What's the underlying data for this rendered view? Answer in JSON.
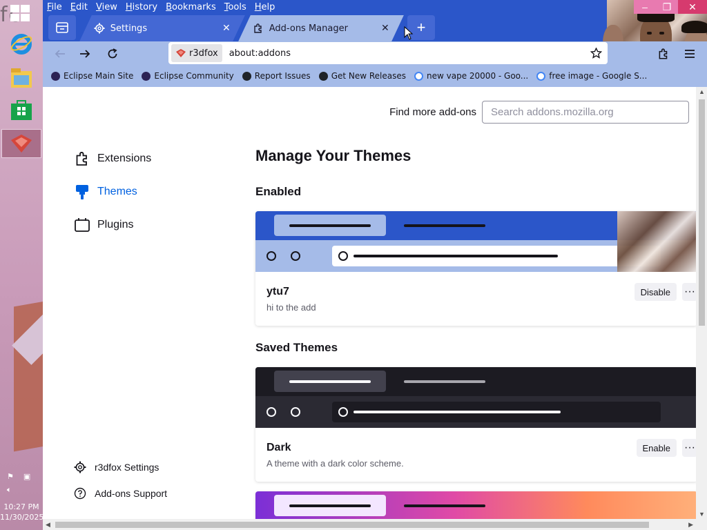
{
  "desktop": {
    "corner_text": "fc",
    "tray": {
      "time": "10:27 PM",
      "date": "11/30/2025"
    }
  },
  "menubar": [
    "File",
    "Edit",
    "View",
    "History",
    "Bookmarks",
    "Tools",
    "Help"
  ],
  "window_controls": {
    "minimize": "–",
    "restore": "❐",
    "close": "✕"
  },
  "tabs": [
    {
      "label": "Settings",
      "icon": "gear-icon",
      "selected": false
    },
    {
      "label": "Add-ons Manager",
      "icon": "puzzle-icon",
      "selected": true
    }
  ],
  "new_tab_label": "+",
  "urlbar": {
    "identity": "r3dfox",
    "url": "about:addons"
  },
  "bookmarks": [
    {
      "label": "Eclipse Main Site",
      "icon": "eclipse-icon",
      "color": "#2c2255"
    },
    {
      "label": "Eclipse Community",
      "icon": "eclipse-icon",
      "color": "#2c2255"
    },
    {
      "label": "Report Issues",
      "icon": "github-icon",
      "color": "#1f2328"
    },
    {
      "label": "Get New Releases",
      "icon": "github-icon",
      "color": "#1f2328"
    },
    {
      "label": "new vape 20000 - Goo...",
      "icon": "google-icon",
      "color": "#4285f4"
    },
    {
      "label": "free image - Google S...",
      "icon": "google-icon",
      "color": "#4285f4"
    }
  ],
  "find_more": {
    "label": "Find more add-ons",
    "placeholder": "Search addons.mozilla.org"
  },
  "sidebar": {
    "items": [
      {
        "label": "Extensions",
        "icon": "puzzle-icon",
        "selected": false
      },
      {
        "label": "Themes",
        "icon": "brush-icon",
        "selected": true
      },
      {
        "label": "Plugins",
        "icon": "plugin-icon",
        "selected": false
      }
    ],
    "footer": [
      {
        "label": "r3dfox Settings",
        "icon": "gear-icon"
      },
      {
        "label": "Add-ons Support",
        "icon": "help-icon"
      }
    ]
  },
  "main": {
    "title": "Manage Your Themes",
    "enabled_heading": "Enabled",
    "saved_heading": "Saved Themes",
    "enabled_theme": {
      "name": "ytu7",
      "description": "hi to the add",
      "action": "Disable"
    },
    "saved_themes": [
      {
        "name": "Dark",
        "description": "A theme with a dark color scheme.",
        "action": "Enable"
      }
    ],
    "more_label": "···"
  },
  "colors": {
    "accent": "#0061e0",
    "titlebar": "#2b56c9",
    "toolbar": "#a5bbe8"
  }
}
